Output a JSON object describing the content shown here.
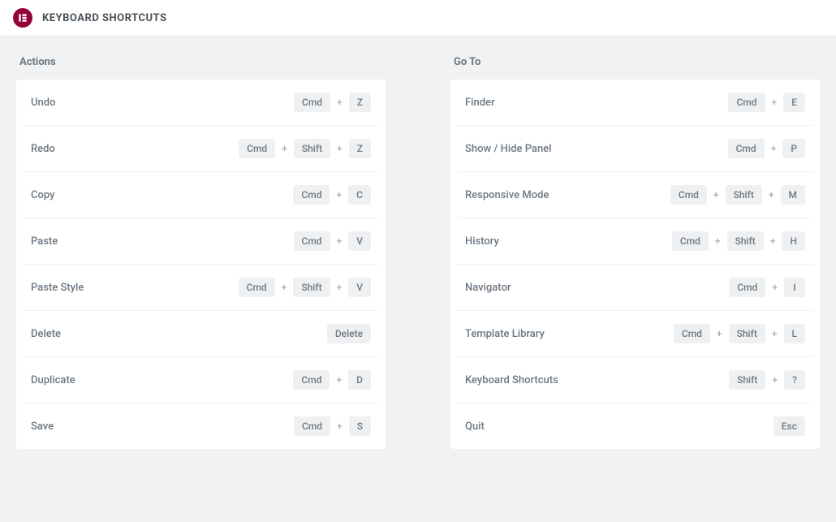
{
  "header": {
    "title": "KEYBOARD SHORTCUTS"
  },
  "columns": [
    {
      "title": "Actions",
      "rows": [
        {
          "label": "Undo",
          "keys": [
            "Cmd",
            "Z"
          ]
        },
        {
          "label": "Redo",
          "keys": [
            "Cmd",
            "Shift",
            "Z"
          ]
        },
        {
          "label": "Copy",
          "keys": [
            "Cmd",
            "C"
          ]
        },
        {
          "label": "Paste",
          "keys": [
            "Cmd",
            "V"
          ]
        },
        {
          "label": "Paste Style",
          "keys": [
            "Cmd",
            "Shift",
            "V"
          ]
        },
        {
          "label": "Delete",
          "keys": [
            "Delete"
          ]
        },
        {
          "label": "Duplicate",
          "keys": [
            "Cmd",
            "D"
          ]
        },
        {
          "label": "Save",
          "keys": [
            "Cmd",
            "S"
          ]
        }
      ]
    },
    {
      "title": "Go To",
      "rows": [
        {
          "label": "Finder",
          "keys": [
            "Cmd",
            "E"
          ]
        },
        {
          "label": "Show / Hide Panel",
          "keys": [
            "Cmd",
            "P"
          ]
        },
        {
          "label": "Responsive Mode",
          "keys": [
            "Cmd",
            "Shift",
            "M"
          ]
        },
        {
          "label": "History",
          "keys": [
            "Cmd",
            "Shift",
            "H"
          ]
        },
        {
          "label": "Navigator",
          "keys": [
            "Cmd",
            "I"
          ]
        },
        {
          "label": "Template Library",
          "keys": [
            "Cmd",
            "Shift",
            "L"
          ]
        },
        {
          "label": "Keyboard Shortcuts",
          "keys": [
            "Shift",
            "?"
          ]
        },
        {
          "label": "Quit",
          "keys": [
            "Esc"
          ]
        }
      ]
    }
  ],
  "plus": "+"
}
